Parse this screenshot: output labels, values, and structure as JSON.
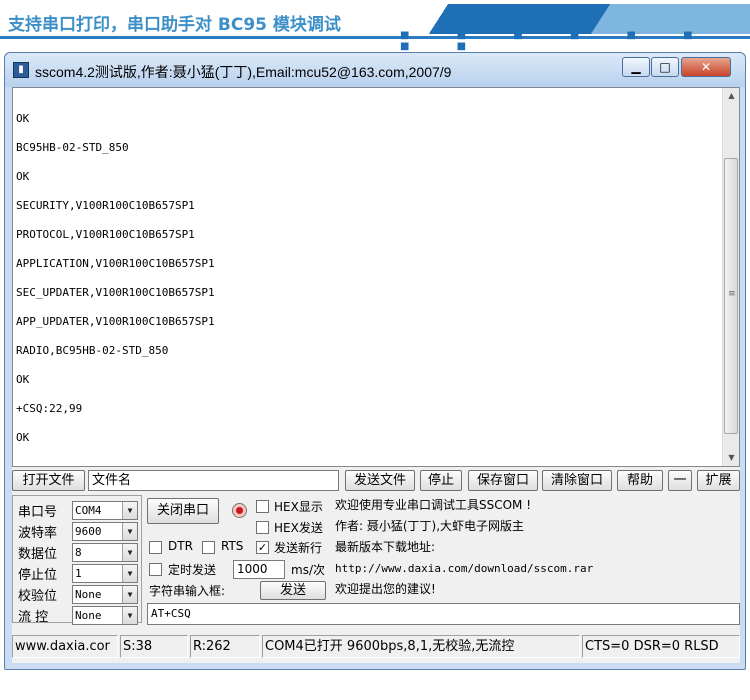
{
  "banner": {
    "title": "支持串口打印，串口助手对 BC95 模块调试"
  },
  "window": {
    "title": "sscom4.2测试版,作者:聂小猛(丁丁),Email:mcu52@163.com,2007/9",
    "minimize": "▁",
    "maximize": "□",
    "close": "✕"
  },
  "receive": {
    "lines": [
      "OK",
      "BC95HB-02-STD_850",
      "OK",
      "SECURITY,V100R100C10B657SP1",
      "PROTOCOL,V100R100C10B657SP1",
      "APPLICATION,V100R100C10B657SP1",
      "SEC_UPDATER,V100R100C10B657SP1",
      "APP_UPDATER,V100R100C10B657SP1",
      "RADIO,BC95HB-02-STD_850",
      "OK",
      "+CSQ:22,99",
      "OK"
    ]
  },
  "toolbar": {
    "open_file": "打开文件",
    "filename": "文件名",
    "send_file": "发送文件",
    "stop": "停止",
    "save_window": "保存窗口",
    "clear_window": "清除窗口",
    "help": "帮助",
    "dash": "一",
    "expand": "扩展"
  },
  "settings": {
    "port_label": "串口号",
    "port_value": "COM4",
    "baud_label": "波特率",
    "baud_value": "9600",
    "databits_label": "数据位",
    "databits_value": "8",
    "stopbits_label": "停止位",
    "stopbits_value": "1",
    "parity_label": "校验位",
    "parity_value": "None",
    "flow_label": "流 控",
    "flow_value": "None"
  },
  "controls": {
    "close_port": "关闭串口",
    "hex_display": "HEX显示",
    "hex_send": "HEX发送",
    "dtr": "DTR",
    "rts": "RTS",
    "send_newline": "发送新行",
    "send_newline_checked": "✓",
    "timed_send": "定时发送",
    "interval": "1000",
    "interval_unit": "ms/次",
    "input_label": "字符串输入框:",
    "send": "发送",
    "send_text": "AT+CSQ"
  },
  "info": {
    "line1": "欢迎使用专业串口调试工具SSCOM !",
    "line2": "作者: 聂小猛(丁丁),大虾电子网版主",
    "line3": "最新版本下载地址:",
    "line4": "http://www.daxia.com/download/sscom.rar",
    "line5": "欢迎提出您的建议!"
  },
  "status": {
    "site": "www.daxia.cor",
    "sent": "S:38",
    "received": "R:262",
    "port_status": "COM4已打开  9600bps,8,1,无校验,无流控",
    "signals": "CTS=0 DSR=0 RLSD"
  }
}
